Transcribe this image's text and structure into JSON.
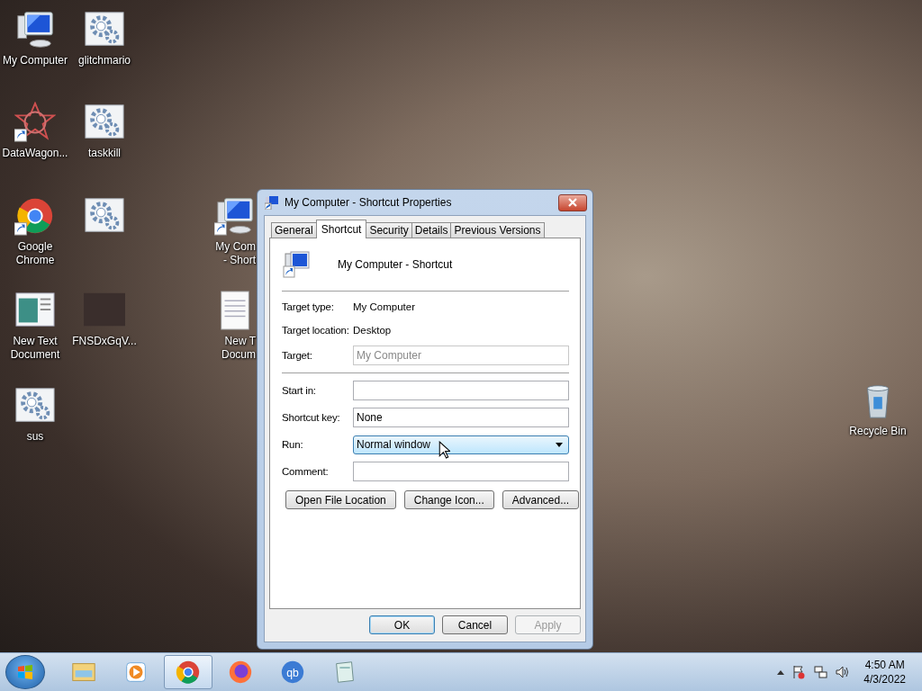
{
  "desktop": {
    "icons": [
      {
        "kind": "computer",
        "shortcut": false,
        "label": "My Computer"
      },
      {
        "kind": "gear",
        "shortcut": false,
        "label": "glitchmario"
      },
      {
        "kind": "star-pattern",
        "shortcut": true,
        "label": "DataWagon..."
      },
      {
        "kind": "gear",
        "shortcut": false,
        "label": "taskkill"
      },
      {
        "kind": "chrome",
        "shortcut": true,
        "label": "Google Chrome"
      },
      {
        "kind": "gear",
        "shortcut": false
      },
      {
        "kind": "computer",
        "shortcut": true,
        "label": "My Com\n- Short"
      },
      {
        "kind": "document-image",
        "shortcut": false,
        "label": "New Text Document"
      },
      {
        "kind": "photo",
        "shortcut": false,
        "label": "FNSDxGqV..."
      },
      {
        "kind": "text-file",
        "shortcut": false,
        "label": "New T\nDocum"
      },
      {
        "kind": "gear",
        "shortcut": false,
        "label": "sus"
      },
      {
        "kind": "recycle-bin",
        "shortcut": false,
        "label": "Recycle Bin"
      }
    ]
  },
  "dialog": {
    "title": "My Computer - Shortcut Properties",
    "tabs": [
      {
        "label": "General",
        "selected": false
      },
      {
        "label": "Shortcut",
        "selected": true
      },
      {
        "label": "Security",
        "selected": false
      },
      {
        "label": "Details",
        "selected": false
      },
      {
        "label": "Previous Versions",
        "selected": false
      }
    ],
    "header": "My Computer - Shortcut",
    "rows": [
      {
        "kind": "text",
        "label": "Target type:",
        "value": "My Computer"
      },
      {
        "kind": "text",
        "label": "Target location:",
        "value": "Desktop"
      },
      {
        "kind": "field",
        "label": "Target:",
        "value": "My Computer",
        "disabled": true
      },
      {
        "kind": "divider"
      },
      {
        "kind": "field",
        "label": "Start in:",
        "disabled": false
      },
      {
        "kind": "field",
        "label": "Shortcut key:",
        "value": "None",
        "disabled": false
      },
      {
        "kind": "dropdown",
        "label": "Run:",
        "value": "Normal window"
      },
      {
        "kind": "field",
        "label": "Comment:",
        "disabled": false
      }
    ],
    "actions": [
      "Open File Location",
      "Change Icon...",
      "Advanced..."
    ],
    "buttons": [
      {
        "label": "OK",
        "default": true,
        "disabled": false
      },
      {
        "label": "Cancel",
        "default": false,
        "disabled": false
      },
      {
        "label": "Apply",
        "default": false,
        "disabled": true
      }
    ]
  },
  "taskbar": {
    "items": [
      {
        "kind": "folder",
        "selected": false
      },
      {
        "kind": "media-player",
        "selected": false
      },
      {
        "kind": "chrome",
        "selected": true
      },
      {
        "kind": "firefox",
        "selected": false
      },
      {
        "kind": "qbittorrent",
        "selected": false,
        "logo_text": "qb"
      },
      {
        "kind": "notepad",
        "selected": false
      }
    ],
    "clock": {
      "time": "4:50 AM",
      "date": "4/3/2022"
    }
  }
}
